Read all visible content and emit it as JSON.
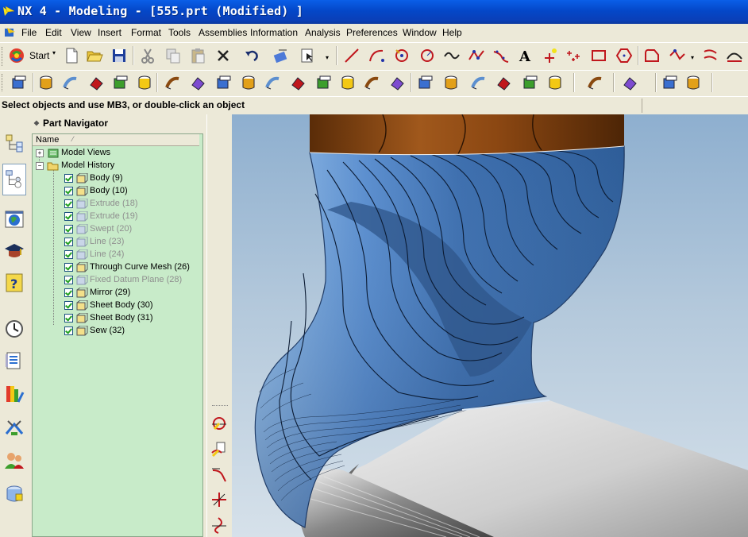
{
  "window": {
    "title": "NX 4 - Modeling - [555.prt (Modified) ]"
  },
  "menubar": {
    "items": [
      {
        "label": "File"
      },
      {
        "label": "Edit"
      },
      {
        "label": "View"
      },
      {
        "label": "Insert"
      },
      {
        "label": "Format"
      },
      {
        "label": "Tools"
      },
      {
        "label": "Assemblies"
      },
      {
        "label": "Information"
      },
      {
        "label": "Analysis"
      },
      {
        "label": "Preferences"
      },
      {
        "label": "Window"
      },
      {
        "label": "Help"
      }
    ]
  },
  "toolbar": {
    "start_label": "Start",
    "row1_icons": [
      "new-file-icon",
      "open-folder-icon",
      "save-icon",
      "cut-icon",
      "copy-icon",
      "paste-icon",
      "delete-icon",
      "undo-icon",
      "wrap-icon",
      "select-filter-icon",
      "line-icon",
      "arc-icon",
      "circle-point-icon",
      "circle-icon",
      "spline-icon",
      "studio-spline-icon",
      "fit-spline-icon",
      "text-icon",
      "point-icon",
      "point-set-icon",
      "rectangle-icon",
      "polygon-icon",
      "sketch-icon",
      "curve-icon",
      "offset-curve-icon",
      "bridge-icon"
    ],
    "row2_icons": [
      "part-navigator-icon",
      "block-icon",
      "cylinder-icon",
      "sweep-icon",
      "tube-icon",
      "extrude-icon",
      "revolve-icon",
      "hole-icon",
      "boss-icon",
      "pad-icon",
      "pocket-icon",
      "slot-icon",
      "groove-icon",
      "edge-blend-icon",
      "chamfer-icon",
      "shell-icon",
      "thicken-icon",
      "box-icon",
      "cyl-icon",
      "cone-icon",
      "sphere-icon",
      "unite-icon",
      "shade-icon",
      "wireframe-icon",
      "render-icon",
      "more-icon"
    ]
  },
  "status": {
    "message": "Select objects and use MB3, or double-click an object"
  },
  "part_navigator": {
    "title": "Part Navigator",
    "column_name": "Name",
    "sort_indicator": "⁄",
    "groups": [
      {
        "label": "Model Views",
        "expanded": false
      },
      {
        "label": "Model History",
        "expanded": true
      }
    ],
    "features": [
      {
        "label": "Body (9)",
        "suppressed": false,
        "icon": "body-icon"
      },
      {
        "label": "Body (10)",
        "suppressed": false,
        "icon": "body-icon"
      },
      {
        "label": "Extrude (18)",
        "suppressed": true,
        "icon": "extrude-icon"
      },
      {
        "label": "Extrude (19)",
        "suppressed": true,
        "icon": "extrude-icon"
      },
      {
        "label": "Swept (20)",
        "suppressed": true,
        "icon": "swept-icon"
      },
      {
        "label": "Line (23)",
        "suppressed": true,
        "icon": "line-icon"
      },
      {
        "label": "Line (24)",
        "suppressed": true,
        "icon": "line-icon"
      },
      {
        "label": "Through Curve Mesh (26)",
        "suppressed": false,
        "icon": "mesh-icon"
      },
      {
        "label": "Fixed Datum Plane (28)",
        "suppressed": true,
        "icon": "datum-plane-icon"
      },
      {
        "label": "Mirror (29)",
        "suppressed": false,
        "icon": "mirror-icon"
      },
      {
        "label": "Sheet Body (30)",
        "suppressed": false,
        "icon": "sheet-body-icon"
      },
      {
        "label": "Sheet Body (31)",
        "suppressed": false,
        "icon": "sheet-body-icon"
      },
      {
        "label": "Sew (32)",
        "suppressed": false,
        "icon": "sew-icon"
      }
    ]
  },
  "resource_bar": {
    "icons": [
      "assembly-navigator-icon",
      "part-navigator-icon",
      "web-browser-icon",
      "training-icon",
      "help-icon",
      "history-icon",
      "reuse-library-icon",
      "palette-icon",
      "roles-icon",
      "systems-icon",
      "materials-icon"
    ]
  },
  "colors": {
    "title_bar": "#0a4fd8",
    "navigator_bg": "#c8ebc9",
    "model_surface": "#6a9fd8",
    "model_top": "#8a4a10"
  }
}
